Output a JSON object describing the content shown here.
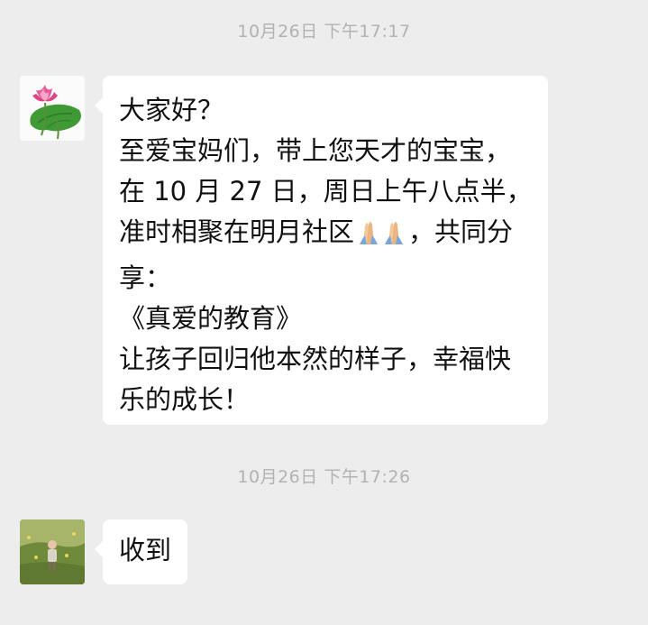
{
  "chat": {
    "messages": [
      {
        "timestamp": "10月26日 下午17:17",
        "lines": [
          "大家好？",
          "至爱宝妈们，带上您天才的宝宝，",
          "在 10 月 27 日，周日上午八点半，",
          "准时相聚在明月社区",
          "，共同分",
          "享：",
          "《真爱的教育》",
          "让孩子回归他本然的样子，幸福快",
          "乐的成长！"
        ],
        "avatar_icon": "lotus-flower-icon",
        "emoji_icon": "folded-hands-icon"
      },
      {
        "timestamp": "10月26日 下午17:26",
        "text": "收到",
        "avatar_icon": "child-photo-avatar"
      }
    ]
  },
  "colors": {
    "background": "#ededed",
    "bubble": "#ffffff",
    "timestamp": "#b2b2b2",
    "text": "#111111"
  }
}
